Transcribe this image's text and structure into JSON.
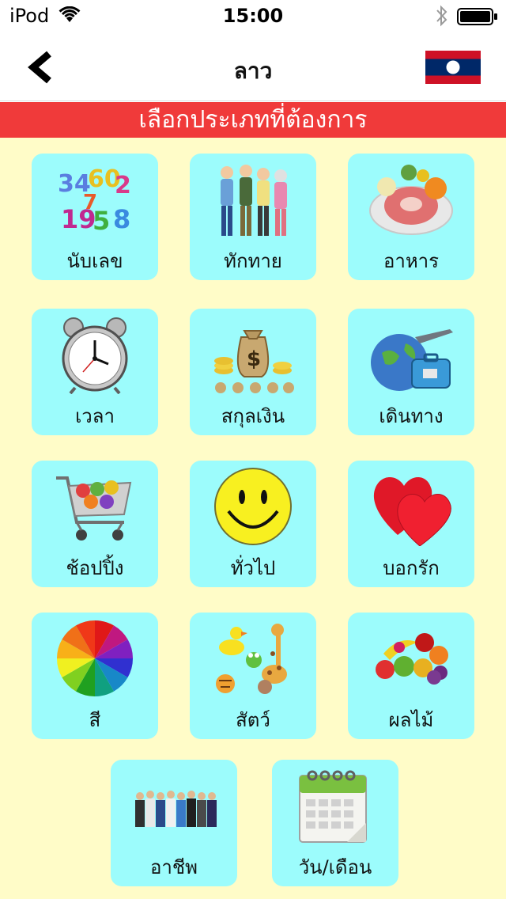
{
  "status_bar": {
    "carrier": "iPod",
    "time": "15:00"
  },
  "nav": {
    "title": "ลาว",
    "back_label": "back"
  },
  "section": {
    "title": "เลือกประเภทที่ต้องการ"
  },
  "categories": [
    {
      "label": "นับเลข",
      "icon": "numbers-icon"
    },
    {
      "label": "ทักทาย",
      "icon": "people-greeting-icon"
    },
    {
      "label": "อาหาร",
      "icon": "food-plate-icon"
    },
    {
      "label": "เวลา",
      "icon": "alarm-clock-icon"
    },
    {
      "label": "สกุลเงิน",
      "icon": "money-bags-icon"
    },
    {
      "label": "เดินทาง",
      "icon": "travel-icon"
    },
    {
      "label": "ช้อปปิ้ง",
      "icon": "shopping-cart-icon"
    },
    {
      "label": "ทั่วไป",
      "icon": "smiley-icon"
    },
    {
      "label": "บอกรัก",
      "icon": "hearts-icon"
    },
    {
      "label": "สี",
      "icon": "color-wheel-icon"
    },
    {
      "label": "สัตว์",
      "icon": "animals-icon"
    },
    {
      "label": "ผลไม้",
      "icon": "fruits-icon"
    },
    {
      "label": "อาชีพ",
      "icon": "professions-icon"
    },
    {
      "label": "วัน/เดือน",
      "icon": "calendar-icon"
    }
  ],
  "colors": {
    "header_red": "#f03a3a",
    "background": "#fffcc8",
    "tile": "#9cfcfc"
  }
}
